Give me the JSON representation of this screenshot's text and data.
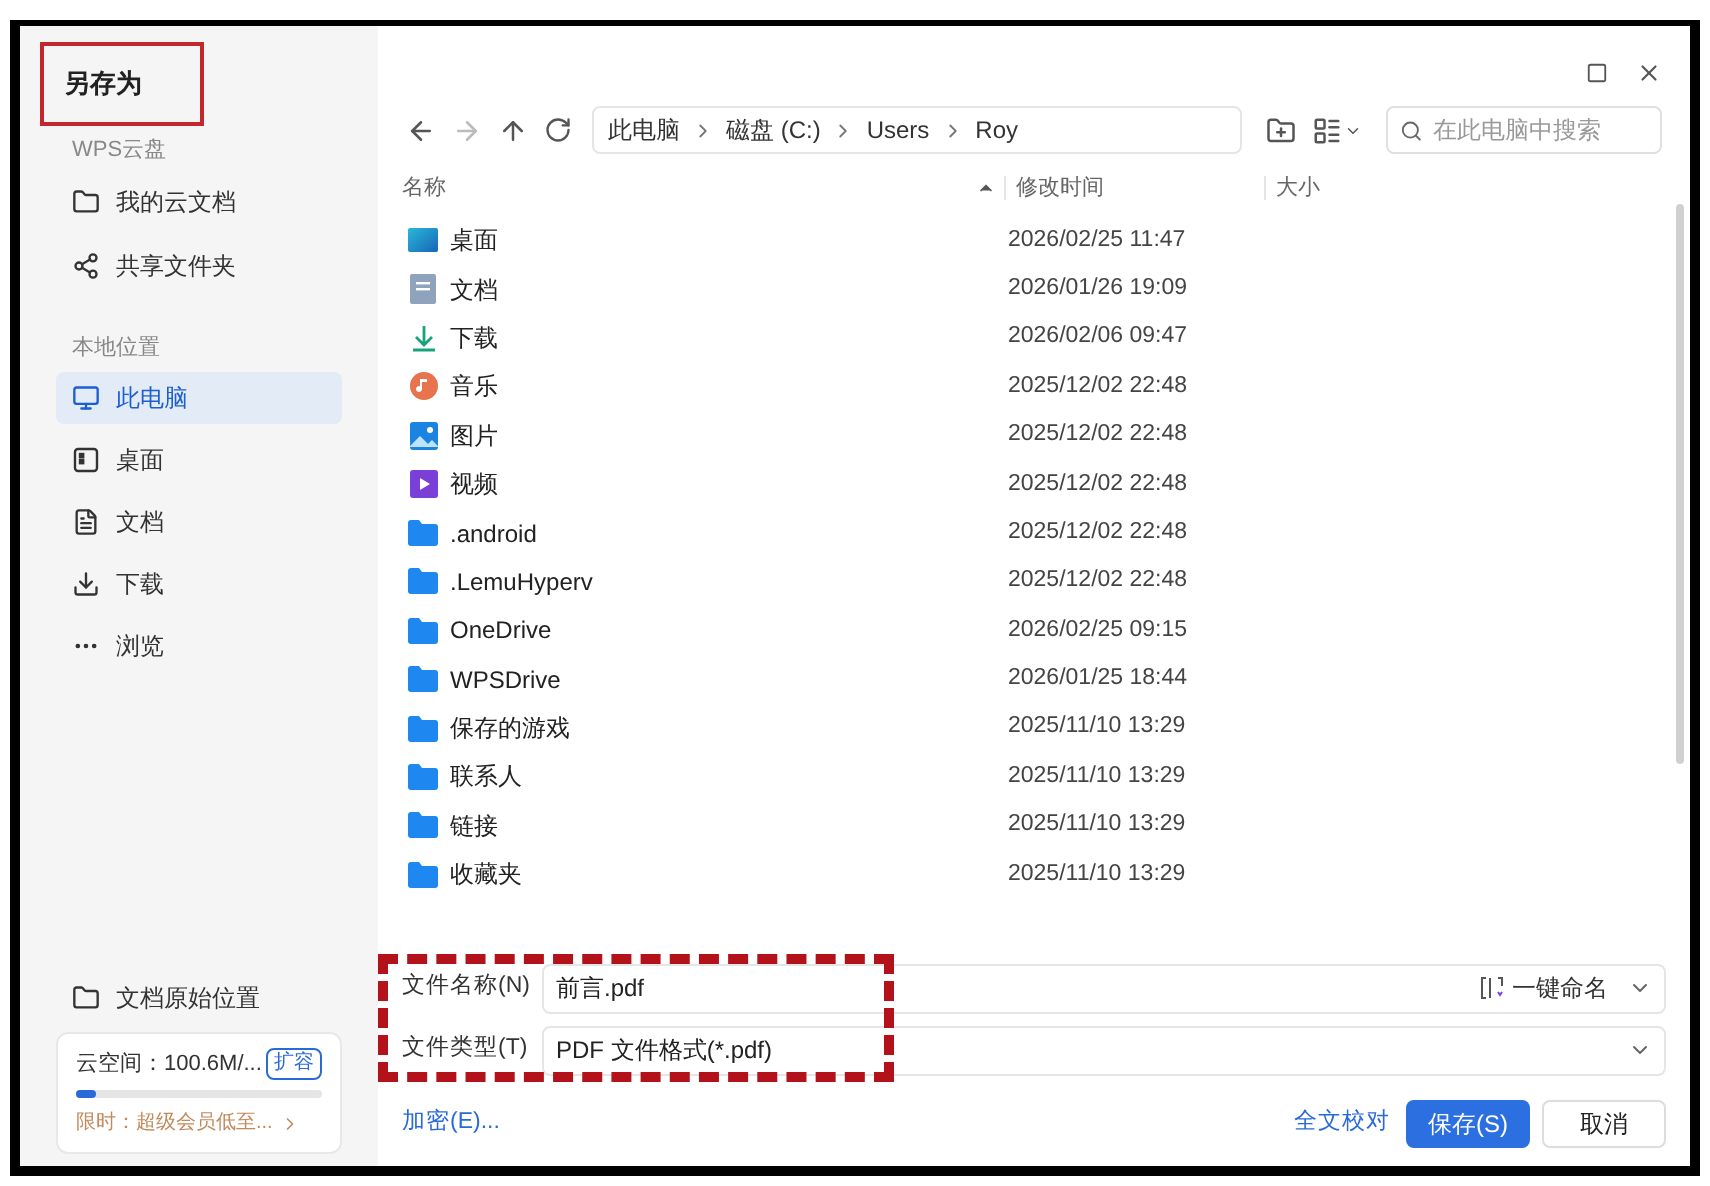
{
  "window": {
    "title": "另存为"
  },
  "sidebar": {
    "cloud_heading": "WPS云盘",
    "cloud_items": [
      {
        "label": "我的云文档",
        "kind": "folder",
        "selected": false
      },
      {
        "label": "共享文件夹",
        "kind": "share",
        "selected": false
      }
    ],
    "local_heading": "本地位置",
    "local_items": [
      {
        "label": "此电脑",
        "kind": "computer",
        "selected": true
      },
      {
        "label": "桌面",
        "kind": "desktop",
        "selected": false
      },
      {
        "label": "文档",
        "kind": "document",
        "selected": false
      },
      {
        "label": "下载",
        "kind": "download",
        "selected": false
      },
      {
        "label": "浏览",
        "kind": "more",
        "selected": false
      }
    ],
    "original_location": "文档原始位置",
    "storage": {
      "text": "云空间：100.6M/...",
      "expand_button": "扩容",
      "level": 0.08,
      "promo": "限时：超级会员低至..."
    }
  },
  "toolbar": {
    "path": [
      "此电脑",
      "磁盘 (C:)",
      "Users",
      "Roy"
    ],
    "search_placeholder": "在此电脑中搜索"
  },
  "columns": [
    "名称",
    "修改时间",
    "大小"
  ],
  "files": [
    {
      "name": "桌面",
      "kind": "desktop",
      "modified": "2026/02/25 11:47"
    },
    {
      "name": "文档",
      "kind": "document",
      "modified": "2026/01/26 19:09"
    },
    {
      "name": "下载",
      "kind": "download",
      "modified": "2026/02/06 09:47"
    },
    {
      "name": "音乐",
      "kind": "music",
      "modified": "2025/12/02 22:48"
    },
    {
      "name": "图片",
      "kind": "picture",
      "modified": "2025/12/02 22:48"
    },
    {
      "name": "视频",
      "kind": "video",
      "modified": "2025/12/02 22:48"
    },
    {
      "name": ".android",
      "kind": "folder",
      "modified": "2025/12/02 22:48"
    },
    {
      "name": ".LemuHyperv",
      "kind": "folder",
      "modified": "2025/12/02 22:48"
    },
    {
      "name": "OneDrive",
      "kind": "folder",
      "modified": "2026/02/25 09:15"
    },
    {
      "name": "WPSDrive",
      "kind": "folder",
      "modified": "2026/01/25 18:44"
    },
    {
      "name": "保存的游戏",
      "kind": "folder",
      "modified": "2025/11/10 13:29"
    },
    {
      "name": "联系人",
      "kind": "folder",
      "modified": "2025/11/10 13:29"
    },
    {
      "name": "链接",
      "kind": "folder",
      "modified": "2025/11/10 13:29"
    },
    {
      "name": "收藏夹",
      "kind": "folder",
      "modified": "2025/11/10 13:29"
    }
  ],
  "form": {
    "filename_label": "文件名称(N)",
    "filename": "前言.pdf",
    "rename_button": "一键命名",
    "filetype_label": "文件类型(T)",
    "filetype": "PDF 文件格式(*.pdf)"
  },
  "footer": {
    "encrypt_link": "加密(E)...",
    "proofread_link": "全文校对",
    "save_button": "保存(S)",
    "cancel_button": "取消"
  }
}
